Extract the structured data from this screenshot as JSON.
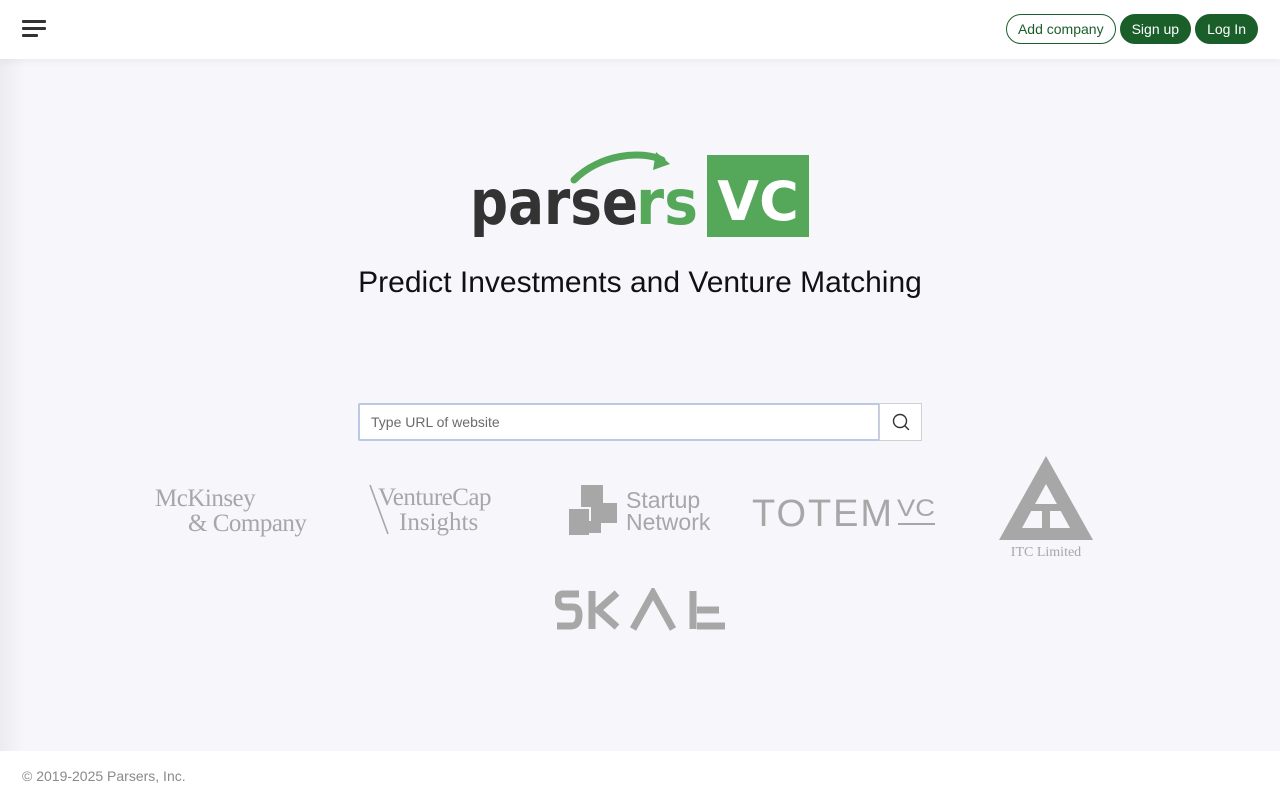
{
  "header": {
    "add_company_label": "Add company",
    "sign_up_label": "Sign up",
    "log_in_label": "Log In"
  },
  "logo": {
    "text_left": "parse",
    "text_green": "rs",
    "box_text": "VC"
  },
  "hero": {
    "tagline": "Predict Investments and Venture Matching"
  },
  "search": {
    "placeholder": "Type URL of website",
    "value": ""
  },
  "partners": {
    "mckinsey": {
      "line1": "McKinsey",
      "line2": "& Company"
    },
    "venturecap": {
      "line1": "VentureCap",
      "line2": "Insights"
    },
    "startup_network": {
      "line1": "Startup",
      "line2": "Network"
    },
    "totem": {
      "text": "TOTEM",
      "suffix": "VC"
    },
    "itc": {
      "text": "ITC Limited"
    },
    "skael": {
      "icon": "skael-wordmark"
    }
  },
  "footer": {
    "copyright": "© 2019-2025 Parsers, Inc."
  },
  "colors": {
    "brand_green": "#55a85a",
    "dark_green": "#1a5e2a",
    "logo_dark": "#333333",
    "partner_gray": "#a7a7a7",
    "background": "#f7f7fb"
  }
}
